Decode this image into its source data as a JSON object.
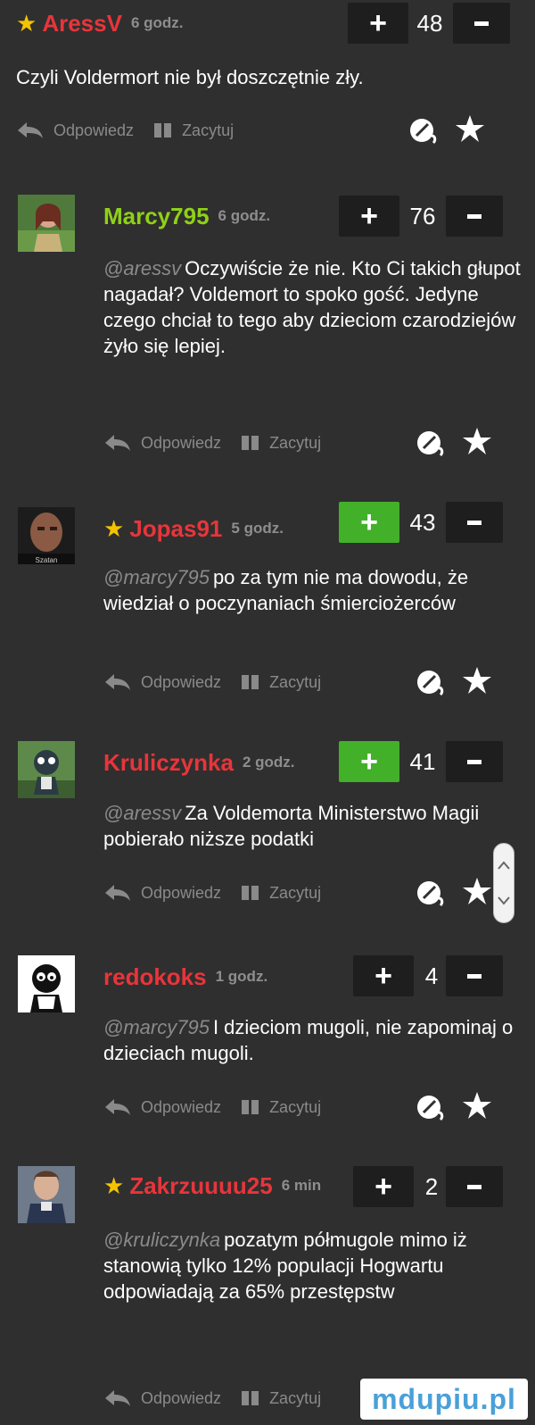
{
  "actions": {
    "reply": "Odpowiedz",
    "quote": "Zacytuj"
  },
  "comments": [
    {
      "username": "AressV",
      "username_color": "#e8353b",
      "starred": true,
      "time": "6 godz.",
      "score": "48",
      "plus_active": false,
      "mention": "",
      "text": "Czyli Voldermort nie był doszczętnie zły."
    },
    {
      "username": "Marcy795",
      "username_color": "#8fd117",
      "starred": false,
      "time": "6 godz.",
      "score": "76",
      "plus_active": false,
      "mention": "@aressv",
      "text": "Oczywiście że nie. Kto Ci takich głupot nagadał? Voldemort to spoko gość. Jedyne czego chciał to tego aby dzieciom czarodziejów żyło się lepiej."
    },
    {
      "username": "Jopas91",
      "username_color": "#e8353b",
      "starred": true,
      "time": "5 godz.",
      "score": "43",
      "plus_active": true,
      "mention": "@marcy795",
      "text": "po za tym nie ma dowodu, że wiedział o poczynaniach śmierciożerców",
      "avatar_caption": "Szatan"
    },
    {
      "username": "Kruliczynka",
      "username_color": "#e8353b",
      "starred": false,
      "time": "2 godz.",
      "score": "41",
      "plus_active": true,
      "mention": "@aressv",
      "text": "Za Voldemorta Ministerstwo Magii pobierało niższe podatki"
    },
    {
      "username": "redokoks",
      "username_color": "#e8353b",
      "starred": false,
      "time": "1 godz.",
      "score": "4",
      "plus_active": false,
      "mention": "@marcy795",
      "text": "I dzieciom mugoli, nie zapominaj o dzieciach mugoli."
    },
    {
      "username": "Zakrzuuuu25",
      "username_color": "#e8353b",
      "starred": true,
      "time": "6 min",
      "score": "2",
      "plus_active": false,
      "mention": "@kruliczynka",
      "text": "pozatym półmugole mimo iż stanowią tylko 12% populacji Hogwartu odpowiadają za 65% przestępstw"
    }
  ],
  "watermark": "mdupiu.pl",
  "icons": {
    "star": "star-icon",
    "reply": "reply-arrow-icon",
    "quote": "quote-icon",
    "report": "report-icon",
    "favorite": "favorite-star-icon"
  },
  "colors": {
    "background": "#2f2f2f",
    "green_vote": "#43b02a",
    "dark_button": "#1e1e1e",
    "muted": "#8a8a8a"
  }
}
